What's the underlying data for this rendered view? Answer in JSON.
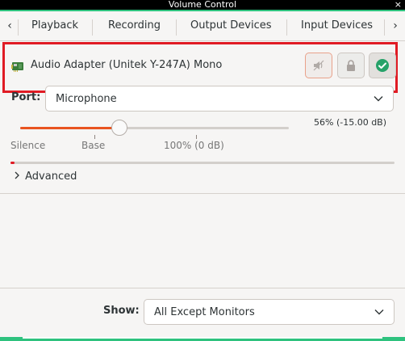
{
  "window": {
    "title": "Volume Control",
    "close_glyph": "×"
  },
  "tabs": {
    "prev_glyph": "‹",
    "next_glyph": "›",
    "items": [
      {
        "label": "Playback"
      },
      {
        "label": "Recording"
      },
      {
        "label": "Output Devices"
      },
      {
        "label": "Input Devices"
      }
    ]
  },
  "device": {
    "icon": "sound-card-icon",
    "name": "Audio Adapter (Unitek Y-247A) Mono",
    "buttons": {
      "mute": "mute-icon",
      "lock": "lock-icon",
      "default": "checkmark-icon"
    },
    "port_label": "Port:",
    "port_value": "Microphone",
    "volume_readout": "56% (-15.00 dB)",
    "volume_fraction": 0.37,
    "marks": {
      "silence": "Silence",
      "base": "Base",
      "full": "100% (0 dB)"
    },
    "level_fraction": 0.01,
    "advanced_label": "Advanced"
  },
  "footer": {
    "show_label": "Show:",
    "show_value": "All Except Monitors"
  },
  "colors": {
    "accent": "#e95420",
    "highlight": "#e01b24",
    "success": "#26a269",
    "frame": "#2ec27e"
  }
}
